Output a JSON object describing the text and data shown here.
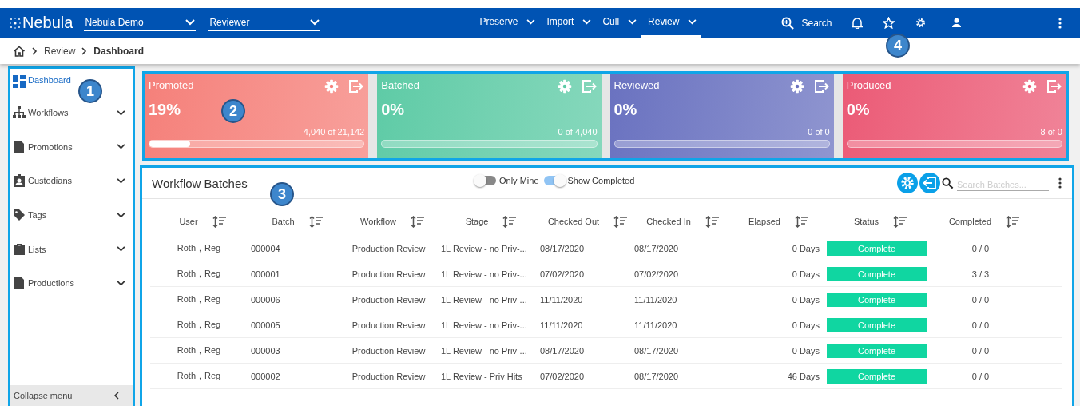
{
  "topbar": {
    "logo": "Nebula",
    "selects": [
      {
        "value": "Nebula Demo"
      },
      {
        "value": "Reviewer"
      }
    ],
    "nav": [
      {
        "label": "Preserve",
        "selected": false
      },
      {
        "label": "Import",
        "selected": false
      },
      {
        "label": "Cull",
        "selected": false
      },
      {
        "label": "Review",
        "selected": true
      }
    ],
    "search": "Search"
  },
  "breadcrumb": [
    "Review",
    "Dashboard"
  ],
  "sidebar": {
    "items": [
      {
        "label": "Dashboard",
        "selected": true,
        "expandable": false
      },
      {
        "label": "Workflows",
        "selected": false,
        "expandable": true
      },
      {
        "label": "Promotions",
        "selected": false,
        "expandable": true
      },
      {
        "label": "Custodians",
        "selected": false,
        "expandable": true
      },
      {
        "label": "Tags",
        "selected": false,
        "expandable": true
      },
      {
        "label": "Lists",
        "selected": false,
        "expandable": true
      },
      {
        "label": "Productions",
        "selected": false,
        "expandable": true
      }
    ],
    "footer": "Collapse menu"
  },
  "cards": [
    {
      "title": "Promoted",
      "percent": "19%",
      "count": "4,040 of 21,142",
      "level": 0.19,
      "color": "#f5807a"
    },
    {
      "title": "Batched",
      "percent": "0%",
      "count": "0 of 4,040",
      "color": "#5ecba6"
    },
    {
      "title": "Reviewed",
      "percent": "0%",
      "count": "0 of 0",
      "color": "#6a72c0"
    },
    {
      "title": "Produced",
      "percent": "0%",
      "count": "8 of 0",
      "color": "#eb5a76"
    }
  ],
  "panel": {
    "title": "Workflow Batches",
    "toggles": [
      {
        "label": "Only Mine",
        "on": false
      },
      {
        "label": "Show Completed",
        "on": true
      }
    ],
    "search_placeholder": "Search Batches...",
    "columns": [
      "User",
      "Batch",
      "Workflow",
      "Stage",
      "Checked Out",
      "Checked In",
      "Elapsed",
      "Status",
      "Completed"
    ],
    "rows": [
      [
        "Roth，Reg",
        "000004",
        "Production Review",
        "1L Review - no Priv-...",
        "08/17/2020",
        "08/17/2020",
        "0 Days",
        "Complete",
        "0 / 0"
      ],
      [
        "Roth，Reg",
        "000001",
        "Production Review",
        "1L Review - no Priv-...",
        "07/02/2020",
        "07/02/2020",
        "0 Days",
        "Complete",
        "3 / 3"
      ],
      [
        "Roth，Reg",
        "000006",
        "Production Review",
        "1L Review - no Priv-...",
        "11/11/2020",
        "11/11/2020",
        "0 Days",
        "Complete",
        "0 / 0"
      ],
      [
        "Roth，Reg",
        "000005",
        "Production Review",
        "1L Review - no Priv-...",
        "11/11/2020",
        "11/11/2020",
        "0 Days",
        "Complete",
        "0 / 0"
      ],
      [
        "Roth，Reg",
        "000003",
        "Production Review",
        "1L Review - no Priv-...",
        "08/17/2020",
        "08/17/2020",
        "0 Days",
        "Complete",
        "0 / 0"
      ],
      [
        "Roth，Reg",
        "000002",
        "Production Review",
        "1L Review - Priv Hits",
        "07/02/2020",
        "08/17/2020",
        "46 Days",
        "Complete",
        "0 / 0"
      ]
    ]
  },
  "callouts": [
    "1",
    "2",
    "3",
    "4"
  ]
}
